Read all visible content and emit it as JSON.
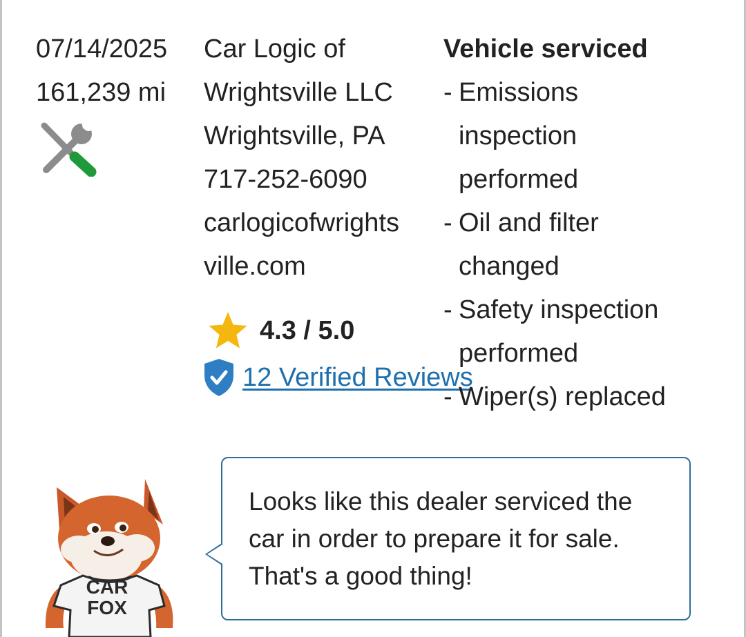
{
  "record": {
    "date": "07/14/2025",
    "mileage": "161,239 mi",
    "icon": "tools-icon",
    "dealer": {
      "name_line1": "Car Logic of",
      "name_line2": "Wrightsville LLC",
      "location": "Wrightsville, PA",
      "phone": "717-252-6090",
      "website_line1": "carlogicofwrights",
      "website_line2": "ville.com",
      "rating": "4.3 / 5.0",
      "reviews_link": "12 Verified Reviews"
    },
    "service": {
      "title": "Vehicle serviced",
      "items": [
        {
          "line1": "Emissions",
          "line2": "inspection",
          "line3": "performed"
        },
        {
          "line1": "Oil and filter",
          "line2": "changed"
        },
        {
          "line1": "Safety inspection",
          "line2": "performed"
        },
        {
          "line1": "Wiper(s) replaced"
        }
      ]
    }
  },
  "fox": {
    "shirt_line1": "CAR",
    "shirt_line2": "FOX",
    "message": "Looks like this dealer serviced the car in order to prepare it for sale. That's a good thing!"
  },
  "colors": {
    "link": "#1d6fae",
    "bubble_border": "#2d6e99",
    "star": "#f5b70f",
    "shield": "#2f7ec4",
    "tool_gray": "#8c8c8c",
    "tool_green": "#1f9a3a"
  }
}
